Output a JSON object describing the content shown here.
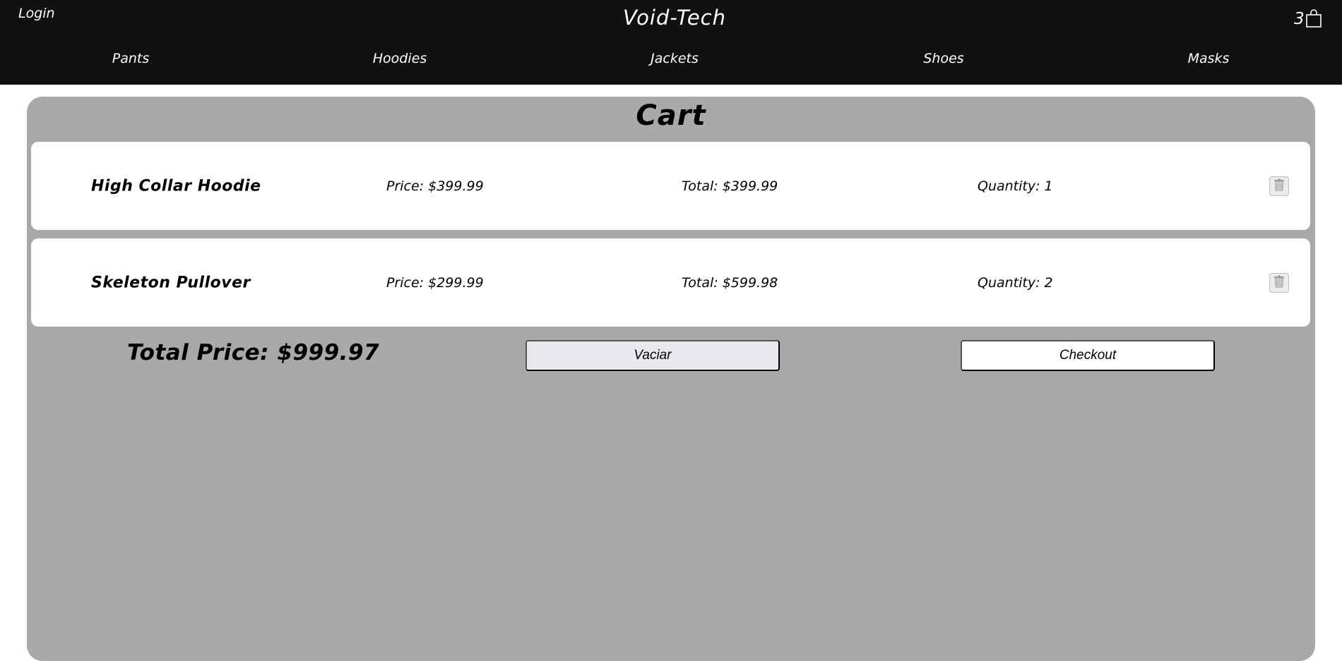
{
  "header": {
    "login_label": "Login",
    "brand": "Void-Tech",
    "cart_count": "3",
    "cart_icon": "shopping-bag-icon"
  },
  "nav": {
    "items": [
      {
        "label": "Pants"
      },
      {
        "label": "Hoodies"
      },
      {
        "label": "Jackets"
      },
      {
        "label": "Shoes"
      },
      {
        "label": "Masks"
      }
    ]
  },
  "cart": {
    "title": "Cart",
    "items": [
      {
        "name": "High Collar Hoodie",
        "price": "Price: $399.99",
        "total": "Total: $399.99",
        "quantity": "Quantity: 1",
        "remove_icon": "trash-icon"
      },
      {
        "name": "Skeleton Pullover",
        "price": "Price: $299.99",
        "total": "Total: $599.98",
        "quantity": "Quantity: 2",
        "remove_icon": "trash-icon"
      }
    ],
    "total_price": "Total Price: $999.97",
    "clear_label": "Vaciar",
    "checkout_label": "Checkout"
  },
  "colors": {
    "header_bg": "#111111",
    "panel_bg": "#a9a9a9",
    "row_bg": "#ffffff",
    "clear_button_bg": "#e9e9ed"
  }
}
